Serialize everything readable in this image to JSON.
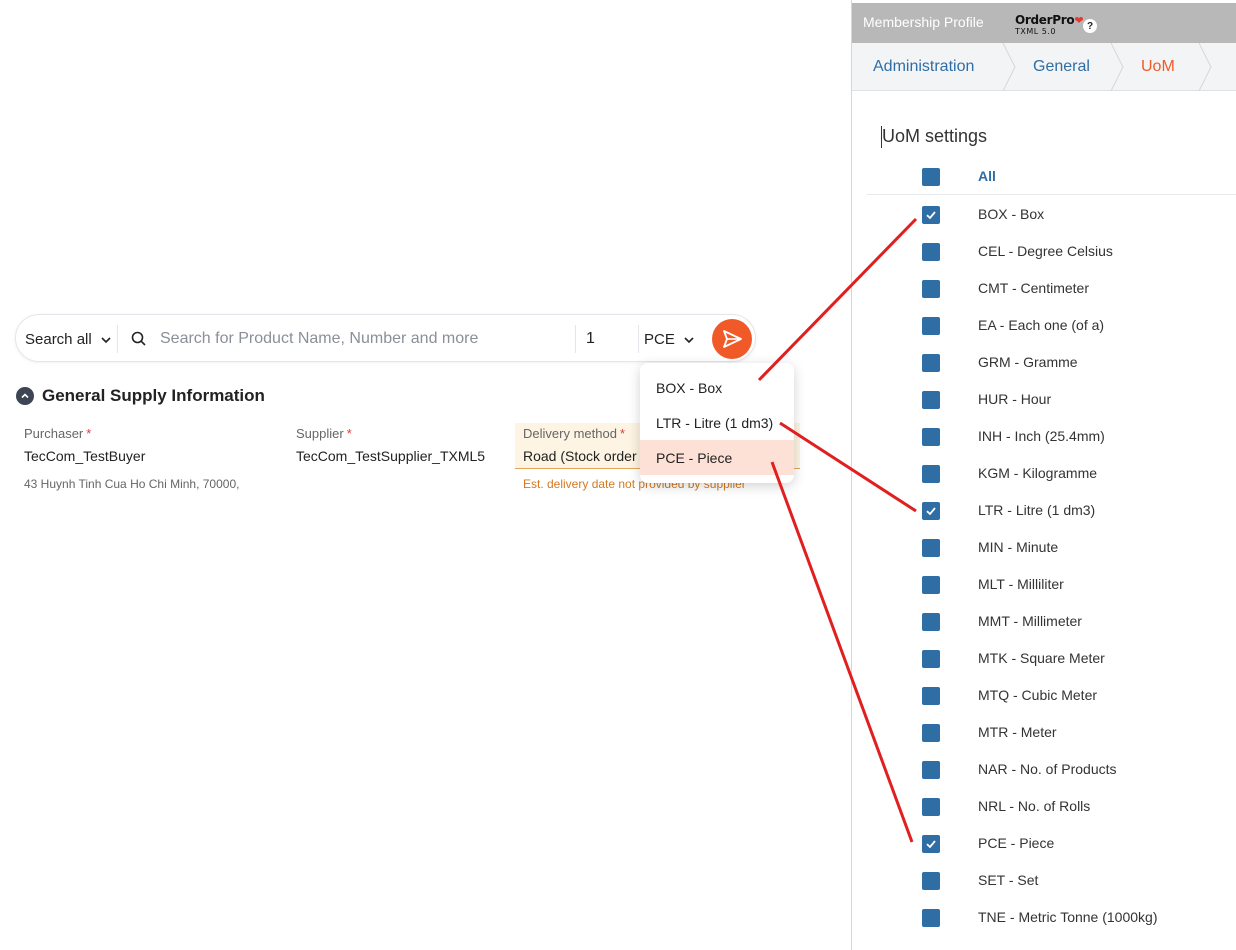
{
  "search": {
    "scope_label": "Search all",
    "placeholder": "Search for Product Name, Number and more",
    "quantity": "1",
    "uom_selected": "PCE"
  },
  "section": {
    "title": "General Supply Information"
  },
  "fields": {
    "purchaser_label": "Purchaser",
    "purchaser_value": "TecCom_TestBuyer",
    "purchaser_address": "43 Huynh Tinh Cua Ho Chi Minh, 70000,",
    "supplier_label": "Supplier",
    "supplier_value": "TecCom_TestSupplier_TXML5",
    "delivery_label": "Delivery method",
    "delivery_value": "Road (Stock order",
    "delivery_note": "Est. delivery date not provided by supplier",
    "required_mark": "*"
  },
  "dropdown": {
    "options": [
      "BOX - Box",
      "LTR - Litre (1 dm3)",
      "PCE - Piece"
    ],
    "selected_index": 2
  },
  "panel": {
    "topbar_title": "Membership Profile",
    "logo_name": "OrderPro",
    "logo_version": "TXML 5.0",
    "help": "?",
    "breadcrumb": [
      "Administration",
      "General",
      "UoM"
    ],
    "settings_title": "UoM settings",
    "all_label": "All",
    "uoms": [
      {
        "label": "BOX - Box",
        "checked": true
      },
      {
        "label": "CEL - Degree Celsius",
        "checked": false
      },
      {
        "label": "CMT - Centimeter",
        "checked": false
      },
      {
        "label": "EA - Each one (of a)",
        "checked": false
      },
      {
        "label": "GRM - Gramme",
        "checked": false
      },
      {
        "label": "HUR - Hour",
        "checked": false
      },
      {
        "label": "INH - Inch (25.4mm)",
        "checked": false
      },
      {
        "label": "KGM - Kilogramme",
        "checked": false
      },
      {
        "label": "LTR - Litre (1 dm3)",
        "checked": true
      },
      {
        "label": "MIN - Minute",
        "checked": false
      },
      {
        "label": "MLT - Milliliter",
        "checked": false
      },
      {
        "label": "MMT - Millimeter",
        "checked": false
      },
      {
        "label": "MTK - Square Meter",
        "checked": false
      },
      {
        "label": "MTQ - Cubic Meter",
        "checked": false
      },
      {
        "label": "MTR - Meter",
        "checked": false
      },
      {
        "label": "NAR - No. of Products",
        "checked": false
      },
      {
        "label": "NRL - No. of Rolls",
        "checked": false
      },
      {
        "label": "PCE - Piece",
        "checked": true
      },
      {
        "label": "SET - Set",
        "checked": false
      },
      {
        "label": "TNE - Metric Tonne (1000kg)",
        "checked": false
      }
    ]
  },
  "colors": {
    "accent": "#f05a28",
    "link_blue": "#2f6ea5",
    "annotation_red": "#e02020"
  }
}
